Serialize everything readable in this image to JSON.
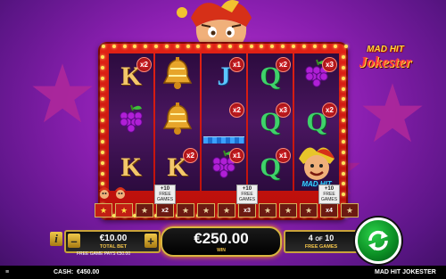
{
  "game": {
    "title": "MAD HIT JOKESTER",
    "logo_top": "MAD HIT",
    "logo_bottom": "Jokester"
  },
  "reels": [
    {
      "symbols": [
        "K",
        "grapes",
        "K"
      ],
      "multipliers": [
        "x2",
        "",
        ""
      ]
    },
    {
      "symbols": [
        "bell",
        "bell",
        "K"
      ],
      "multipliers": [
        "",
        "",
        "x2"
      ]
    },
    {
      "symbols": [
        "J",
        "",
        "grapes"
      ],
      "multipliers": [
        "x1",
        "x2",
        "x1"
      ]
    },
    {
      "symbols": [
        "Q",
        "Q",
        "Q"
      ],
      "multipliers": [
        "x2",
        "x3",
        "x1"
      ]
    },
    {
      "symbols": [
        "grapes",
        "Q",
        "wild"
      ],
      "multipliers": [
        "x3",
        "x2",
        ""
      ]
    }
  ],
  "wild_label": "MAD HIT",
  "feature_strip": [
    {
      "type": "jester",
      "mult": ""
    },
    {
      "type": "jester",
      "mult": ""
    },
    {
      "type": "star",
      "lit": false
    },
    {
      "type": "flag",
      "line1": "+10",
      "line2": "FREE",
      "line3": "GAMES",
      "mult": "x2"
    },
    {
      "type": "star",
      "lit": false
    },
    {
      "type": "star",
      "lit": false
    },
    {
      "type": "star",
      "lit": false
    },
    {
      "type": "flag",
      "line1": "+10",
      "line2": "FREE",
      "line3": "GAMES",
      "mult": "x3"
    },
    {
      "type": "star",
      "lit": false
    },
    {
      "type": "star",
      "lit": false
    },
    {
      "type": "star",
      "lit": false
    },
    {
      "type": "flag",
      "line1": "+10",
      "line2": "FREE",
      "line3": "GAMES",
      "mult": "x4"
    },
    {
      "type": "star",
      "lit": false
    }
  ],
  "bet": {
    "value": "€10.00",
    "label": "TOTAL BET",
    "info_label": "i",
    "minus_label": "–",
    "plus_label": "+"
  },
  "win": {
    "value": "€250.00",
    "label": "WIN"
  },
  "free_games": {
    "current": "4",
    "of_label": "OF",
    "total": "10",
    "label": "FREE GAMES"
  },
  "free_game_pays": "FREE GAME PAYS €50.00",
  "status": {
    "cash_label": "CASH:",
    "cash_value": "€450.00",
    "game_name": "MAD HIT JOKESTER"
  },
  "colors": {
    "frame": "#c8150f",
    "accent_gold": "#d9b640",
    "spin_green": "#12a832",
    "background": "#8a1fb0"
  }
}
